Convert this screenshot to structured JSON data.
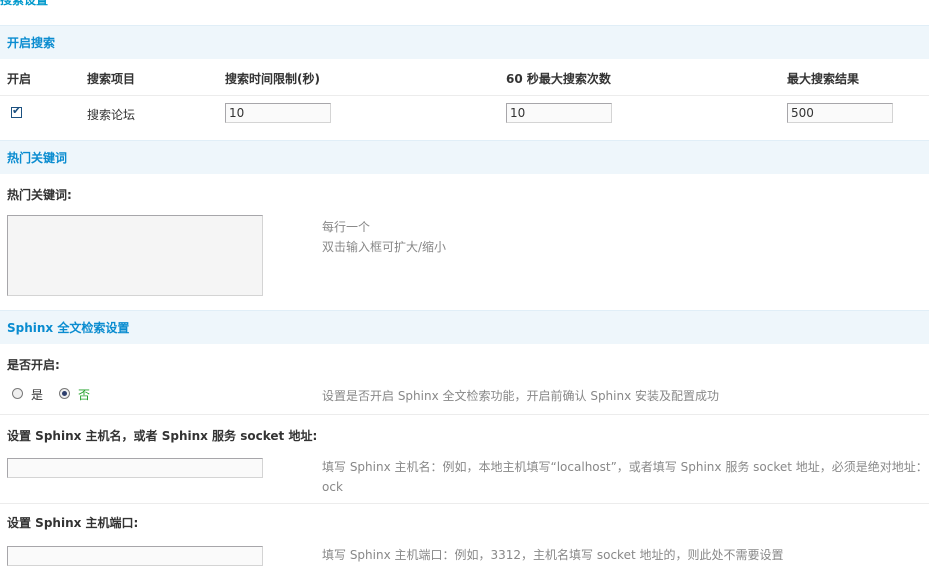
{
  "page": {
    "title": "搜索设置"
  },
  "sections": {
    "enable_search": {
      "header": "开启搜索",
      "columns": [
        "开启",
        "搜索项目",
        "搜索时间限制(秒)",
        "60 秒最大搜索次数",
        "最大搜索结果"
      ],
      "row": {
        "checked": true,
        "item": "搜索论坛",
        "time_limit": "10",
        "max_per_60s": "10",
        "max_results": "500"
      }
    },
    "hot_keywords": {
      "header": "热门关键词",
      "label": "热门关键词:",
      "textarea_value": "",
      "hint_lines": [
        "每行一个",
        "双击输入框可扩大/缩小"
      ]
    },
    "sphinx": {
      "header": "Sphinx 全文检索设置",
      "enable_label": "是否开启:",
      "radio_yes": "是",
      "radio_no": "否",
      "selected": "否",
      "enable_hint": "设置是否开启 Sphinx 全文检索功能，开启前确认 Sphinx 安装及配置成功",
      "host_label": "设置 Sphinx 主机名，或者 Sphinx 服务 socket 地址:",
      "host_value": "",
      "host_hint_line1": "填写 Sphinx 主机名：例如，本地主机填写“localhost”，或者填写 Sphinx 服务 socket 地址，必须是绝对地址：",
      "host_hint_line2": "ock",
      "port_label": "设置 Sphinx 主机端口:",
      "port_value": "",
      "port_hint": "填写 Sphinx 主机端口：例如，3312，主机名填写 socket 地址的，则此处不需要设置"
    }
  }
}
